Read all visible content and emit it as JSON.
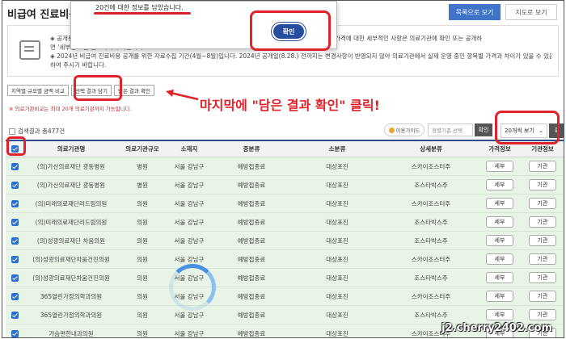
{
  "header": {
    "title": "비급여 진료비용 정보",
    "view_list": "목록으로 보기",
    "view_map": "지도로 보기"
  },
  "notice": {
    "line1": "◈ 공개된 비급여 진료비용은 각 의료기관이 제출한 자료로, 의료기관에서 자율적으로 정한 것으로 공개된 비급여 가격에 대한 세부적인 사항은 의료기관에 확인 또는 공개하",
    "line2": "면 '세부정보'를 참고하시기 바랍니다.",
    "line3": "◈ 2024년 비급여 진료비용 공개를 위한 자료수집 기간(4월~8월)입니다. 2024년 공개일(8.28.) 전까지는 변경사항이 반영되지 않아 의료기관에서 실제 운영 중인 항목별 가격과 차이가 있을 수 있음을 양해",
    "line4": "하여 주시기 바랍니다."
  },
  "modal": {
    "message": "20건에 대한 정보를 담았습니다.",
    "confirm": "확인"
  },
  "tabs": {
    "region": "지역별·규모별 금액 비교",
    "select_save": "선택 결과 담기",
    "saved_check": "담은 결과 확인"
  },
  "hint": "※ 의료기관비교는 최대 20개 의료기관까지 가능합니다.",
  "annotation": {
    "text": "마지막에 \"담은 결과 확인\" 클릭!"
  },
  "results": {
    "count_label": "검색결과 총477건",
    "guide_btn": "이용가이드",
    "sort_placeholder": "정렬기준 선택",
    "sort_confirm": "확인",
    "page_size": "20개씩 보기",
    "page_confirm": "확"
  },
  "table": {
    "headers": [
      "",
      "의료기관명",
      "의료기관규모",
      "소재지",
      "중분류",
      "소분류",
      "상세분류",
      "가격정보",
      "기관정보"
    ],
    "detail_label": "세부",
    "org_label": "기관",
    "rows": [
      {
        "name": "(의)가산의료재단 광동병원",
        "size": "병원",
        "loc": "서울 강남구",
        "mid": "예방접종료",
        "small": "대상포진",
        "detail": "스카이조스터주"
      },
      {
        "name": "(의)가산의료재단 광동병원",
        "size": "병원",
        "loc": "서울 강남구",
        "mid": "예방접종료",
        "small": "대상포진",
        "detail": "조스타박스주"
      },
      {
        "name": "(의)미래의료재단리드림의원",
        "size": "의원",
        "loc": "서울 강남구",
        "mid": "예방접종료",
        "small": "대상포진",
        "detail": "스카이조스터주"
      },
      {
        "name": "(의)미래의료재단리드림의원",
        "size": "의원",
        "loc": "서울 강남구",
        "mid": "예방접종료",
        "small": "대상포진",
        "detail": "조스타박스주"
      },
      {
        "name": "(의)성광의료재단 차움의원",
        "size": "의원",
        "loc": "서울 강남구",
        "mid": "예방접종료",
        "small": "대상포진",
        "detail": "조스타박스주"
      },
      {
        "name": "(의)성광의료재단차움건진의원",
        "size": "의원",
        "loc": "서울 강남구",
        "mid": "예방접종료",
        "small": "대상포진",
        "detail": "스카이조스터주"
      },
      {
        "name": "(의)성광의료재단차움건진의원",
        "size": "의원",
        "loc": "서울 강남구",
        "mid": "예방접종료",
        "small": "대상포진",
        "detail": "조스타박스주"
      },
      {
        "name": "365열린가정의학과의원",
        "size": "의원",
        "loc": "서울 강남구",
        "mid": "예방접종료",
        "small": "대상포진",
        "detail": "스카이조스터주"
      },
      {
        "name": "365열린가정의학과의원",
        "size": "의원",
        "loc": "서울 강남구",
        "mid": "예방접종료",
        "small": "대상포진",
        "detail": "조스타박스주"
      },
      {
        "name": "가슴편한내과의원",
        "size": "의원",
        "loc": "서울 강남구",
        "mid": "예방접종료",
        "small": "대상포진",
        "detail": "스카이조스터주"
      }
    ]
  },
  "watermark": "j2.cherry2402.com",
  "colors": {
    "accent": "#3f74c8",
    "highlight": "#e0222a",
    "row_bg": "#e8f4e6",
    "confirm_btn": "#274d9e"
  }
}
